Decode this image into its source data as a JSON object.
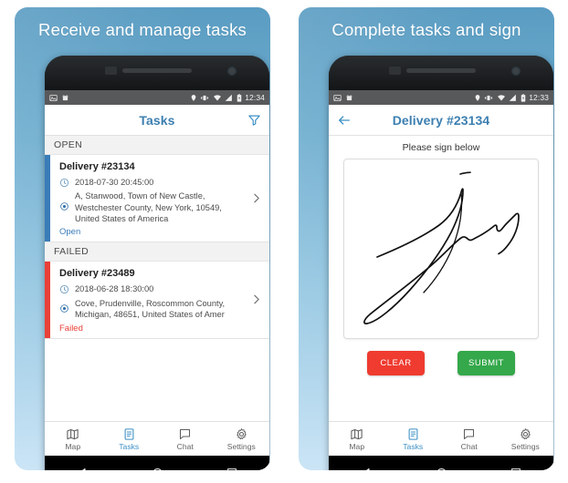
{
  "panels": [
    {
      "headline": "Receive and manage tasks",
      "statusbar": {
        "time": "12:34",
        "left_icons": [
          "image-icon",
          "android-icon"
        ],
        "right_icons": [
          "location-pin-icon",
          "vibrate-icon",
          "wifi-icon",
          "signal-icon",
          "battery-icon"
        ]
      },
      "appbar": {
        "title": "Tasks",
        "action_icon": "filter-funnel-icon"
      },
      "sections": [
        {
          "label": "OPEN",
          "accent_color": "#3a7cb8",
          "task": {
            "title": "Delivery #23134",
            "datetime": "2018-07-30 20:45:00",
            "address": "A, Stanwood, Town of New Castle, Westchester County, New York, 10549, United States of America",
            "status": "Open"
          }
        },
        {
          "label": "FAILED",
          "accent_color": "#e84038",
          "task": {
            "title": "Delivery #23489",
            "datetime": "2018-06-28 18:30:00",
            "address": "Cove, Prudenville, Roscommon County, Michigan, 48651, United States of Amer",
            "status": "Failed"
          }
        }
      ],
      "tabs": [
        {
          "label": "Map",
          "icon": "map-icon",
          "active": false
        },
        {
          "label": "Tasks",
          "icon": "document-list-icon",
          "active": true
        },
        {
          "label": "Chat",
          "icon": "chat-bubble-icon",
          "active": false
        },
        {
          "label": "Settings",
          "icon": "gear-icon",
          "active": false
        }
      ],
      "navbar": [
        "back-triangle-icon",
        "home-circle-icon",
        "recents-square-icon"
      ]
    },
    {
      "headline": "Complete tasks and sign",
      "statusbar": {
        "time": "12:33",
        "left_icons": [
          "image-icon",
          "android-icon"
        ],
        "right_icons": [
          "location-pin-icon",
          "vibrate-icon",
          "wifi-icon",
          "signal-icon",
          "battery-icon"
        ]
      },
      "appbar": {
        "title": "Delivery #23134",
        "back_icon": "arrow-left-icon"
      },
      "sign": {
        "prompt": "Please sign below",
        "clear_label": "CLEAR",
        "submit_label": "SUBMIT",
        "clear_color": "#ef3b30",
        "submit_color": "#34a84a"
      },
      "tabs": [
        {
          "label": "Map",
          "icon": "map-icon",
          "active": false
        },
        {
          "label": "Tasks",
          "icon": "document-list-icon",
          "active": true
        },
        {
          "label": "Chat",
          "icon": "chat-bubble-icon",
          "active": false
        },
        {
          "label": "Settings",
          "icon": "gear-icon",
          "active": false
        }
      ],
      "navbar": [
        "back-triangle-icon",
        "home-circle-icon",
        "recents-square-icon"
      ]
    }
  ],
  "theme": {
    "promo_top": "#5a9cc2",
    "promo_bottom": "#cbe5f6",
    "accent_blue": "#3c7fb1",
    "open_accent": "#3a7cb8",
    "failed_accent": "#e84038"
  }
}
